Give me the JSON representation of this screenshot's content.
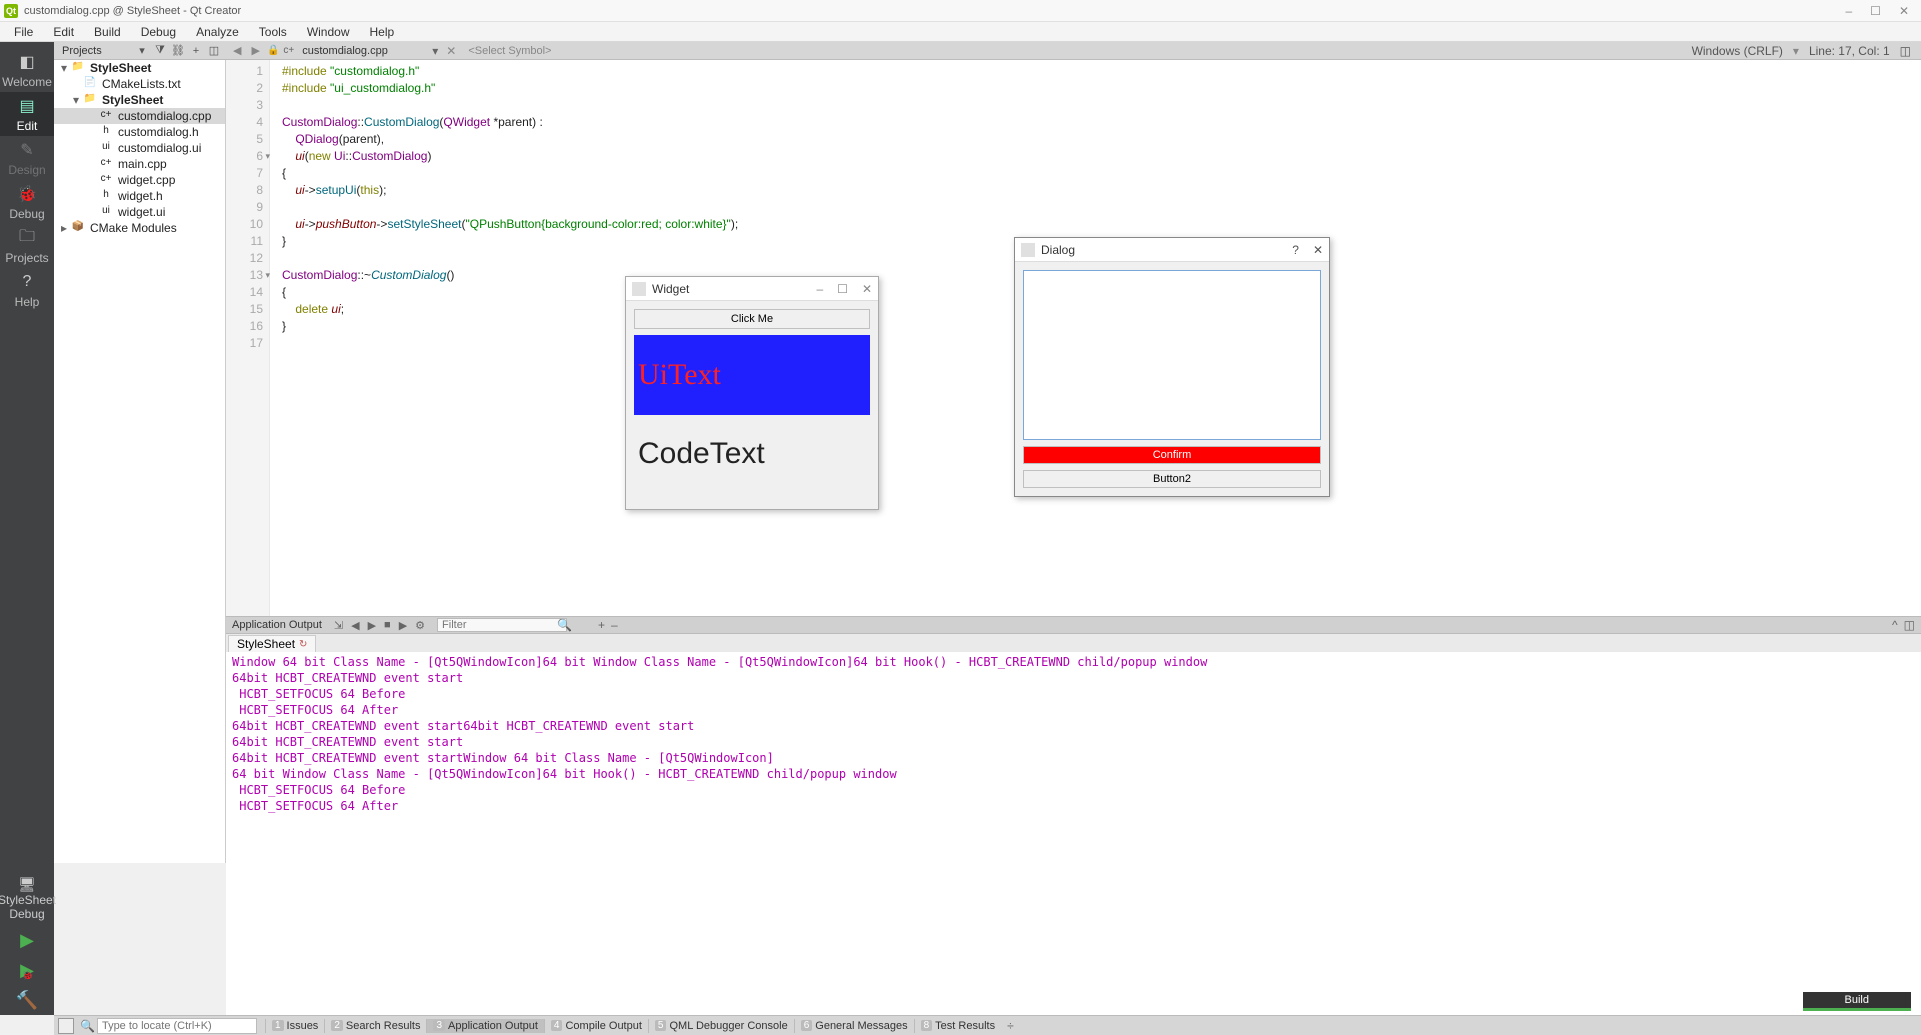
{
  "title": "customdialog.cpp @ StyleSheet - Qt Creator",
  "menus": [
    "File",
    "Edit",
    "Build",
    "Debug",
    "Analyze",
    "Tools",
    "Window",
    "Help"
  ],
  "modes": [
    {
      "label": "Welcome",
      "icon": "◧"
    },
    {
      "label": "Edit",
      "icon": "▤",
      "active": true
    },
    {
      "label": "Design",
      "icon": "✎",
      "disabled": true
    },
    {
      "label": "Debug",
      "icon": "🐞"
    },
    {
      "label": "Projects",
      "icon": "🗀"
    },
    {
      "label": "Help",
      "icon": "?"
    }
  ],
  "kit": {
    "name": "StyleSheet",
    "config": "Debug"
  },
  "project_header": "Projects",
  "tree": [
    {
      "ind": 0,
      "tw": "▾",
      "icon": "📁",
      "name": "StyleSheet",
      "bold": true
    },
    {
      "ind": 1,
      "tw": "",
      "icon": "📄",
      "name": "CMakeLists.txt"
    },
    {
      "ind": 1,
      "tw": "▾",
      "icon": "📁",
      "name": "StyleSheet",
      "bold": true
    },
    {
      "ind": 2,
      "tw": "",
      "icon": "c+",
      "name": "customdialog.cpp",
      "sel": true
    },
    {
      "ind": 2,
      "tw": "",
      "icon": "h",
      "name": "customdialog.h"
    },
    {
      "ind": 2,
      "tw": "",
      "icon": "ui",
      "name": "customdialog.ui"
    },
    {
      "ind": 2,
      "tw": "",
      "icon": "c+",
      "name": "main.cpp"
    },
    {
      "ind": 2,
      "tw": "",
      "icon": "c+",
      "name": "widget.cpp"
    },
    {
      "ind": 2,
      "tw": "",
      "icon": "h",
      "name": "widget.h"
    },
    {
      "ind": 2,
      "tw": "",
      "icon": "ui",
      "name": "widget.ui"
    },
    {
      "ind": 0,
      "tw": "▸",
      "icon": "📦",
      "name": "CMake Modules"
    }
  ],
  "editor_toolbar": {
    "file": "customdialog.cpp",
    "symbol": "<Select Symbol>",
    "encoding": "Windows (CRLF)",
    "position": "Line: 17, Col: 1"
  },
  "code_lines": [
    {
      "n": 1,
      "html": "<span class='kw'>#include</span> <span class='str'>\"customdialog.h\"</span>"
    },
    {
      "n": 2,
      "html": "<span class='kw'>#include</span> <span class='str'>\"ui_customdialog.h\"</span>"
    },
    {
      "n": 3,
      "html": ""
    },
    {
      "n": 4,
      "html": "<span class='cls'>CustomDialog</span>::<span class='fn'>CustomDialog</span>(<span class='cls'>QWidget</span> *parent) :"
    },
    {
      "n": 5,
      "html": "    <span class='cls'>QDialog</span>(parent),"
    },
    {
      "n": 6,
      "html": "    <span class='mem'>ui</span>(<span class='kw'>new</span> <span class='cls'>Ui</span>::<span class='cls'>CustomDialog</span>)",
      "fold": true
    },
    {
      "n": 7,
      "html": "{"
    },
    {
      "n": 8,
      "html": "    <span class='mem'>ui</span>-&gt;<span class='fn'>setupUi</span>(<span class='this-kw'>this</span>);"
    },
    {
      "n": 9,
      "html": ""
    },
    {
      "n": 10,
      "html": "    <span class='mem'>ui</span>-&gt;<span class='mem'>pushButton</span>-&gt;<span class='fn'>setStyleSheet</span>(<span class='str'>\"QPushButton{background-color:red; color:white}\"</span>);"
    },
    {
      "n": 11,
      "html": "}"
    },
    {
      "n": 12,
      "html": ""
    },
    {
      "n": 13,
      "html": "<span class='cls'>CustomDialog</span>::~<span class='fn' style='font-style:italic'>CustomDialog</span>()",
      "fold": true
    },
    {
      "n": 14,
      "html": "{"
    },
    {
      "n": 15,
      "html": "    <span class='kw'>delete</span> <span class='mem'>ui</span>;"
    },
    {
      "n": 16,
      "html": "}"
    },
    {
      "n": 17,
      "html": ""
    }
  ],
  "widget_window": {
    "title": "Widget",
    "button": "Click Me",
    "uitext": "UiText",
    "codetext": "CodeText"
  },
  "dialog_window": {
    "title": "Dialog",
    "confirm": "Confirm",
    "button2": "Button2"
  },
  "output": {
    "header": "Application Output",
    "filter_placeholder": "Filter",
    "tab": "StyleSheet",
    "lines": [
      "Window 64 bit Class Name - [Qt5QWindowIcon]64 bit Window Class Name - [Qt5QWindowIcon]64 bit Hook() - HCBT_CREATEWND child/popup window",
      "64bit HCBT_CREATEWND event start",
      " HCBT_SETFOCUS 64 Before",
      " HCBT_SETFOCUS 64 After",
      "64bit HCBT_CREATEWND event start64bit HCBT_CREATEWND event start",
      "64bit HCBT_CREATEWND event start",
      "64bit HCBT_CREATEWND event startWindow 64 bit Class Name - [Qt5QWindowIcon]",
      "64 bit Window Class Name - [Qt5QWindowIcon]64 bit Hook() - HCBT_CREATEWND child/popup window",
      " HCBT_SETFOCUS 64 Before",
      " HCBT_SETFOCUS 64 After"
    ]
  },
  "build_label": "Build",
  "bottom": {
    "locator_placeholder": "Type to locate (Ctrl+K)",
    "tabs": [
      {
        "n": "1",
        "t": "Issues"
      },
      {
        "n": "2",
        "t": "Search Results"
      },
      {
        "n": "3",
        "t": "Application Output",
        "active": true
      },
      {
        "n": "4",
        "t": "Compile Output"
      },
      {
        "n": "5",
        "t": "QML Debugger Console"
      },
      {
        "n": "6",
        "t": "General Messages"
      },
      {
        "n": "8",
        "t": "Test Results"
      }
    ]
  }
}
